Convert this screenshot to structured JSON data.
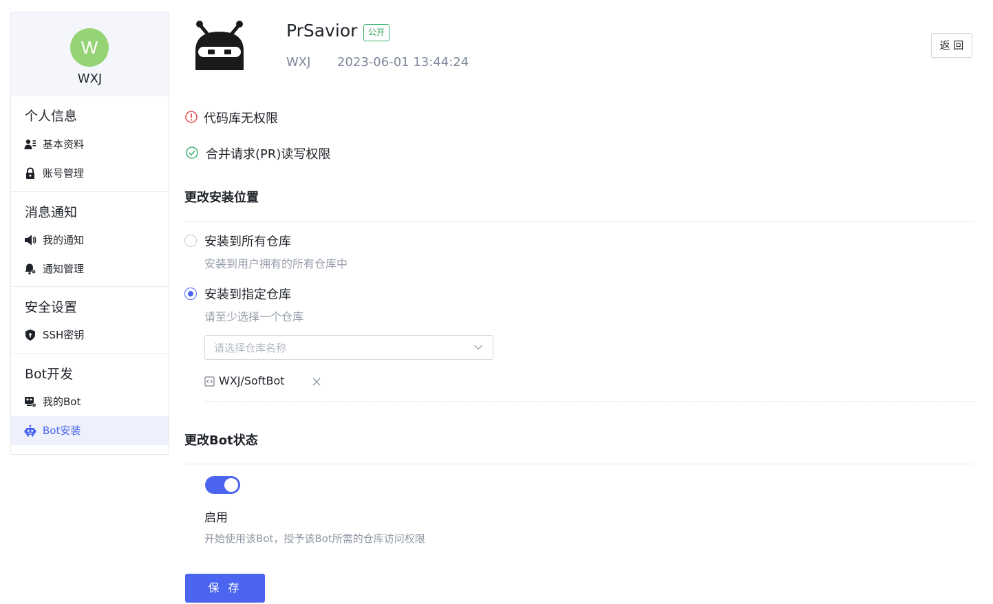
{
  "sidebar": {
    "profile": {
      "initial": "W",
      "name": "WXJ"
    },
    "groups": [
      {
        "title": "个人信息",
        "items": [
          {
            "label": "基本资料",
            "icon": "user-card-icon"
          },
          {
            "label": "账号管理",
            "icon": "lock-icon"
          }
        ]
      },
      {
        "title": "消息通知",
        "items": [
          {
            "label": "我的通知",
            "icon": "speaker-icon"
          },
          {
            "label": "通知管理",
            "icon": "bell-gear-icon"
          }
        ]
      },
      {
        "title": "安全设置",
        "items": [
          {
            "label": "SSH密钥",
            "icon": "shield-icon"
          }
        ]
      },
      {
        "title": "Bot开发",
        "items": [
          {
            "label": "我的Bot",
            "icon": "robot-monitor-icon"
          },
          {
            "label": "Bot安装",
            "icon": "robot-icon",
            "active": true
          }
        ]
      }
    ]
  },
  "header": {
    "bot_name": "PrSavior",
    "visibility_badge": "公开",
    "owner": "WXJ",
    "created_at": "2023-06-01 13:44:24",
    "back_label": "返 回"
  },
  "permissions": [
    {
      "label": "代码库无权限",
      "status": "denied"
    },
    {
      "label": "合并请求(PR)读写权限",
      "status": "granted"
    }
  ],
  "install_location": {
    "title": "更改安装位置",
    "options": [
      {
        "title": "安装到所有仓库",
        "desc": "安装到用户拥有的所有仓库中",
        "checked": false
      },
      {
        "title": "安装到指定仓库",
        "desc": "请至少选择一个仓库",
        "checked": true
      }
    ],
    "repo_select_placeholder": "请选择仓库名称",
    "selected_repos": [
      "WXJ/SoftBot"
    ]
  },
  "bot_status": {
    "title": "更改Bot状态",
    "enabled": true,
    "label": "启用",
    "desc": "开始使用该Bot，授予该Bot所需的仓库访问权限"
  },
  "save_label": "保 存",
  "colors": {
    "accent": "#4b65f0",
    "avatar": "#95d475",
    "success": "#37b36b",
    "error": "#e5484d"
  }
}
